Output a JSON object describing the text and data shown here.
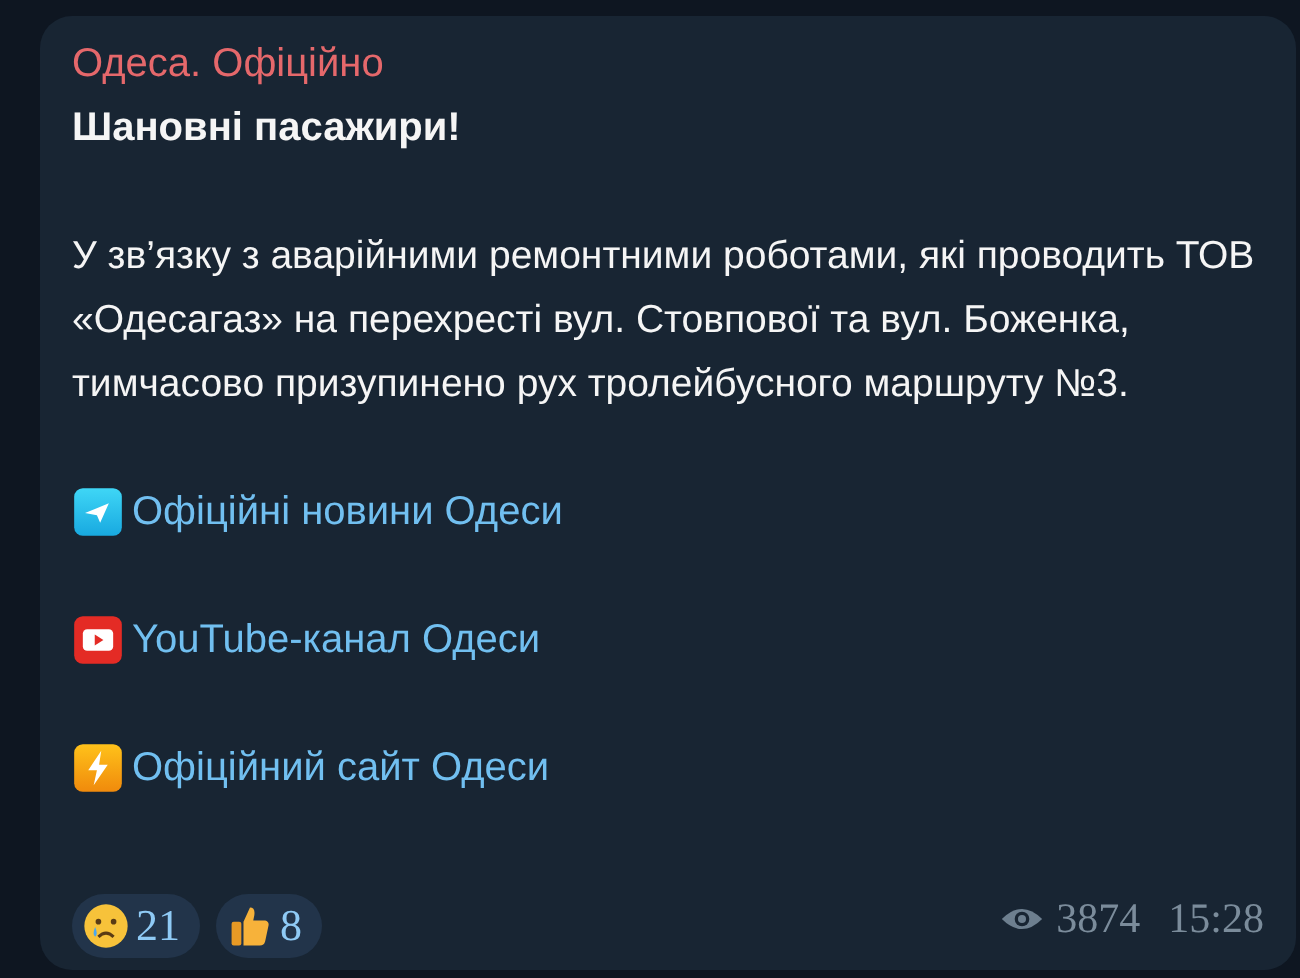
{
  "message": {
    "channel": "Одеса. Офіційно",
    "greeting": "Шановні пасажири!",
    "body": "У зв’язку з аварійними ремонтними роботами, які проводить ТОВ «Одесагаз» на перехресті вул. Стовпової та вул. Боженка, тимчасово призупинено рух тролейбусного маршруту №3.",
    "links": [
      {
        "kind": "telegram",
        "text": "Офіційні новини Одеси"
      },
      {
        "kind": "youtube",
        "text": "YouTube-канал Одеси"
      },
      {
        "kind": "site",
        "text": "Офіційний сайт Одеси"
      }
    ],
    "reactions": [
      {
        "kind": "crying",
        "count": "21"
      },
      {
        "kind": "thumbs-up",
        "count": "8"
      }
    ],
    "views": "3874",
    "time": "15:28"
  }
}
